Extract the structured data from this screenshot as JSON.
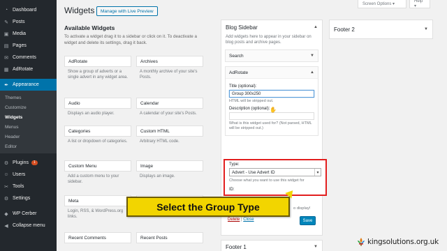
{
  "admin_menu": {
    "items": [
      {
        "label": "Dashboard",
        "icon": "dashboard-icon",
        "glyph": "◔"
      },
      {
        "label": "Posts",
        "icon": "pin-icon",
        "glyph": "✎"
      },
      {
        "label": "Media",
        "icon": "media-icon",
        "glyph": "▣"
      },
      {
        "label": "Pages",
        "icon": "pages-icon",
        "glyph": "▤"
      },
      {
        "label": "Comments",
        "icon": "comment-icon",
        "glyph": "✉"
      },
      {
        "label": "AdRotate",
        "icon": "adrotate-icon",
        "glyph": "▦"
      }
    ],
    "appearance": {
      "label": "Appearance",
      "icon": "brush-icon",
      "glyph": "✒"
    },
    "appearance_sub": [
      "Themes",
      "Customize",
      "Widgets",
      "Menus",
      "Header",
      "Editor"
    ],
    "items2": [
      {
        "label": "Plugins",
        "icon": "plugin-icon",
        "glyph": "⚙",
        "badge": "1"
      },
      {
        "label": "Users",
        "icon": "users-icon",
        "glyph": "☺"
      },
      {
        "label": "Tools",
        "icon": "tools-icon",
        "glyph": "✂"
      },
      {
        "label": "Settings",
        "icon": "settings-icon",
        "glyph": "⚙"
      }
    ],
    "items3": [
      {
        "label": "WP Cerber",
        "icon": "shield-icon",
        "glyph": "◆"
      },
      {
        "label": "Collapse menu",
        "icon": "collapse-icon",
        "glyph": "◀"
      }
    ]
  },
  "header": {
    "title": "Widgets",
    "preview_button": "Manage with Live Preview",
    "screen_options": "Screen Options ▾",
    "help": "Help ▾"
  },
  "available": {
    "title": "Available Widgets",
    "description": "To activate a widget drag it to a sidebar or click on it. To deactivate a widget and delete its settings, drag it back.",
    "widgets": [
      {
        "name": "AdRotate",
        "desc": "Show a group of adverts or a single advert in any widget area."
      },
      {
        "name": "Archives",
        "desc": "A monthly archive of your site's Posts."
      },
      {
        "name": "Audio",
        "desc": "Displays an audio player."
      },
      {
        "name": "Calendar",
        "desc": "A calendar of your site's Posts."
      },
      {
        "name": "Categories",
        "desc": "A list or dropdown of categories."
      },
      {
        "name": "Custom HTML",
        "desc": "Arbitrary HTML code."
      },
      {
        "name": "Custom Menu",
        "desc": "Add a custom menu to your sidebar."
      },
      {
        "name": "Image",
        "desc": "Displays an image."
      },
      {
        "name": "Meta",
        "desc": "Login, RSS, & WordPress.org links."
      },
      {
        "name": "",
        "desc": "s of your site's Pages."
      },
      {
        "name": "Recent Comments",
        "desc": ""
      },
      {
        "name": "Recent Posts",
        "desc": ""
      }
    ]
  },
  "blog_sidebar": {
    "title": "Blog Sidebar",
    "description": "Add widgets here to appear in your sidebar on blog posts and archive pages.",
    "search_widget": "Search",
    "adrotate_widget": {
      "title": "AdRotate",
      "title_label": "Title (optional):",
      "title_value": "Group 300x250",
      "title_hint": "HTML will be stripped out.",
      "desc_label": "Description (optional):",
      "desc_hint": "What is this widget used for? (Not parsed, HTML will be stripped out.)",
      "type_label": "Type:",
      "type_value": "Advert - Use Advert ID",
      "type_hint": "Choose what you want to use this widget for",
      "id_label": "ID:",
      "partial_text": "o display!",
      "delete": "Delete",
      "separator": "|",
      "close": "Close",
      "save": "Save"
    }
  },
  "footer_widgets": {
    "footer2": "Footer 2",
    "footer1": "Footer 1"
  },
  "callout": {
    "text": "Select the Group Type",
    "color": "#f2d500"
  },
  "brand": {
    "logo_text": "kingsolutions.org.uk",
    "highlight_color": "#e21e1e",
    "accent": "#0073aa"
  }
}
